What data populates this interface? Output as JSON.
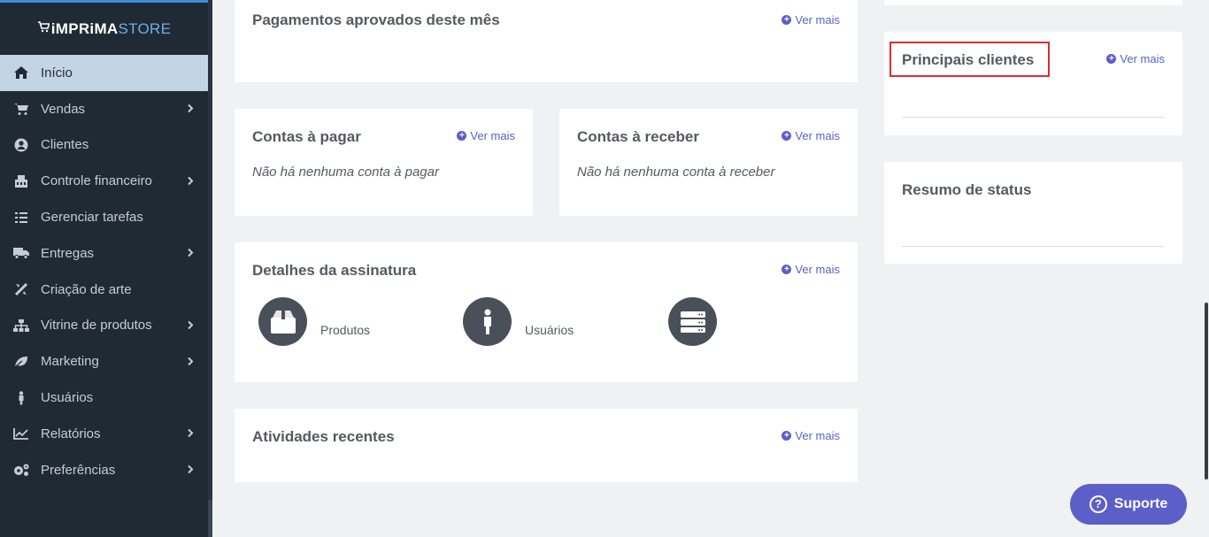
{
  "logo": {
    "brand": "iMPRiMA",
    "suffix": "STORE"
  },
  "sidebar": {
    "items": [
      {
        "label": "Início",
        "icon": "home-icon",
        "active": true,
        "submenu": false
      },
      {
        "label": "Vendas",
        "icon": "cart-icon",
        "active": false,
        "submenu": true
      },
      {
        "label": "Clientes",
        "icon": "user-circle-icon",
        "active": false,
        "submenu": false
      },
      {
        "label": "Controle financeiro",
        "icon": "bank-icon",
        "active": false,
        "submenu": true
      },
      {
        "label": "Gerenciar tarefas",
        "icon": "tasks-icon",
        "active": false,
        "submenu": false
      },
      {
        "label": "Entregas",
        "icon": "truck-icon",
        "active": false,
        "submenu": true
      },
      {
        "label": "Criação de arte",
        "icon": "tools-icon",
        "active": false,
        "submenu": false
      },
      {
        "label": "Vitrine de produtos",
        "icon": "sitemap-icon",
        "active": false,
        "submenu": true
      },
      {
        "label": "Marketing",
        "icon": "leaf-icon",
        "active": false,
        "submenu": true
      },
      {
        "label": "Usuários",
        "icon": "person-icon",
        "active": false,
        "submenu": false
      },
      {
        "label": "Relatórios",
        "icon": "chart-line-icon",
        "active": false,
        "submenu": true
      },
      {
        "label": "Preferências",
        "icon": "cogs-icon",
        "active": false,
        "submenu": true
      }
    ]
  },
  "cards": {
    "payments": {
      "title": "Pagamentos aprovados deste mês",
      "link": "Ver mais"
    },
    "payables": {
      "title": "Contas à pagar",
      "link": "Ver mais",
      "empty": "Não há nenhuma conta à pagar"
    },
    "receivables": {
      "title": "Contas à receber",
      "link": "Ver mais",
      "empty": "Não há nenhuma conta à receber"
    },
    "subscription": {
      "title": "Detalhes da assinatura",
      "link": "Ver mais",
      "items": [
        {
          "label": "Produtos",
          "icon": "box-icon"
        },
        {
          "label": "Usuários",
          "icon": "person-icon"
        },
        {
          "label": "",
          "icon": "server-icon"
        }
      ]
    },
    "activities": {
      "title": "Atividades recentes",
      "link": "Ver mais"
    },
    "top_clients": {
      "title": "Principais clientes",
      "link": "Ver mais"
    },
    "status_summary": {
      "title": "Resumo de status"
    }
  },
  "support": {
    "label": "Suporte"
  },
  "colors": {
    "sidebar": "#1f2a35",
    "active": "#c3d4e6",
    "accent": "#5a5fc8",
    "highlight": "#d9302f"
  }
}
